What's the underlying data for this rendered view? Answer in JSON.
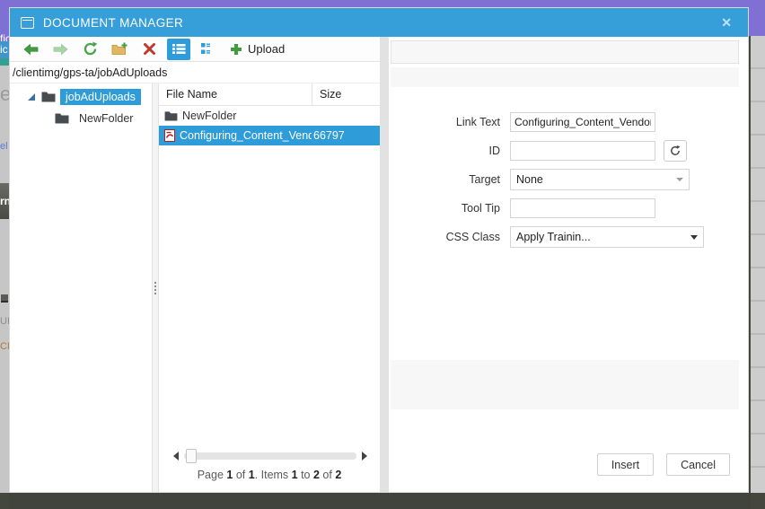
{
  "dialog": {
    "title": "DOCUMENT MANAGER",
    "close_icon": "✕"
  },
  "toolbar": {
    "icons": [
      "back-icon",
      "forward-icon",
      "refresh-icon",
      "new-folder-icon",
      "delete-icon",
      "list-view-icon",
      "grid-view-icon",
      "upload-plus-icon"
    ],
    "upload_label": "Upload",
    "selected_view": "list"
  },
  "path": "/clientimg/gps-ta/jobAdUploads",
  "tree": {
    "items": [
      {
        "label": "jobAdUploads",
        "selected": true
      },
      {
        "label": "NewFolder",
        "selected": false
      }
    ]
  },
  "file_list": {
    "columns": {
      "name": "File Name",
      "size": "Size"
    },
    "rows": [
      {
        "name": "NewFolder",
        "size": "",
        "type": "folder",
        "selected": false
      },
      {
        "name": "Configuring_Content_Vendor",
        "size": "66797",
        "type": "pdf",
        "selected": true
      }
    ]
  },
  "pager": {
    "segments": [
      "Page ",
      "1",
      " of ",
      "1",
      ". Items ",
      "1",
      " to ",
      "2",
      " of ",
      "2"
    ]
  },
  "properties": {
    "link_text": {
      "label": "Link Text",
      "value": "Configuring_Content_Vendor"
    },
    "id": {
      "label": "ID",
      "value": ""
    },
    "target": {
      "label": "Target",
      "value": "None"
    },
    "tool_tip": {
      "label": "Tool Tip",
      "value": ""
    },
    "css_class": {
      "label": "CSS Class",
      "value": "Apply Trainin..."
    }
  },
  "footer": {
    "insert_label": "Insert",
    "cancel_label": "Cancel"
  },
  "background": {
    "fragments": [
      {
        "text": "fic"
      },
      {
        "text": "ic"
      },
      {
        "text": "e"
      },
      {
        "text": "el"
      },
      {
        "text": "rn"
      },
      {
        "text": "UI"
      },
      {
        "text": "CR"
      }
    ]
  },
  "colors": {
    "title_bar_blue": "#369fd9",
    "selection_blue": "#2e9cd9",
    "page_purple": "#8170d4",
    "panel_gray": "#f7f7f7"
  }
}
